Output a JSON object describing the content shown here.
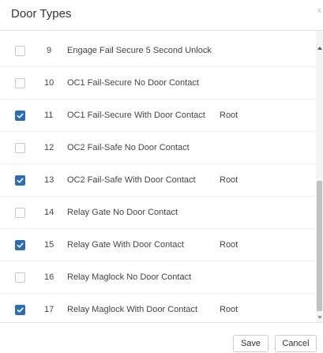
{
  "dialog": {
    "title": "Door Types",
    "close_glyph": "x"
  },
  "items": [
    {
      "number": "9",
      "name": "Engage Fail Secure 5 Second Unlock",
      "owner": "",
      "checked": false
    },
    {
      "number": "10",
      "name": "OC1 Fail-Secure No Door Contact",
      "owner": "",
      "checked": false
    },
    {
      "number": "11",
      "name": "OC1 Fail-Secure With Door Contact",
      "owner": "Root",
      "checked": true
    },
    {
      "number": "12",
      "name": "OC2 Fail-Safe No Door Contact",
      "owner": "",
      "checked": false
    },
    {
      "number": "13",
      "name": "OC2 Fail-Safe With Door Contact",
      "owner": "Root",
      "checked": true
    },
    {
      "number": "14",
      "name": "Relay Gate No Door Contact",
      "owner": "",
      "checked": false
    },
    {
      "number": "15",
      "name": "Relay Gate With Door Contact",
      "owner": "Root",
      "checked": true
    },
    {
      "number": "16",
      "name": "Relay Maglock No Door Contact",
      "owner": "",
      "checked": false
    },
    {
      "number": "17",
      "name": "Relay Maglock With Door Contact",
      "owner": "Root",
      "checked": true
    }
  ],
  "footer": {
    "save_label": "Save",
    "cancel_label": "Cancel"
  },
  "colors": {
    "checkbox_checked": "#2b6cb8",
    "border": "#e5e5e5"
  },
  "icons": {
    "checkmark": "check-icon",
    "scroll_up": "arrow-up-icon",
    "scroll_down": "arrow-down-icon"
  }
}
